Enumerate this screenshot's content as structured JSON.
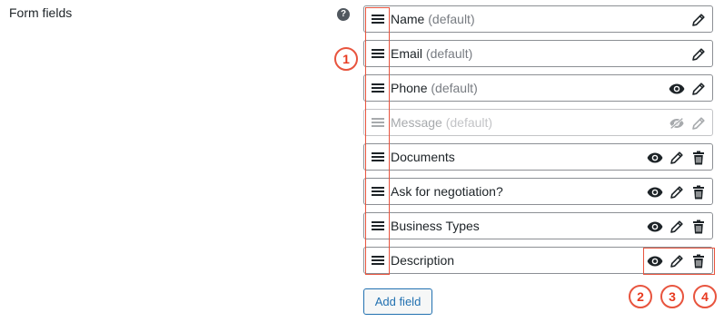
{
  "section": {
    "label": "Form fields",
    "help_icon": "question-circle-icon",
    "help_text": "?"
  },
  "fields": [
    {
      "name": "Name",
      "tag": "(default)",
      "enabled": true,
      "actions": [
        "edit"
      ]
    },
    {
      "name": "Email",
      "tag": "(default)",
      "enabled": true,
      "actions": [
        "edit"
      ]
    },
    {
      "name": "Phone",
      "tag": "(default)",
      "enabled": true,
      "actions": [
        "visibility",
        "edit"
      ]
    },
    {
      "name": "Message",
      "tag": "(default)",
      "enabled": false,
      "actions": [
        "visibility-hidden",
        "edit"
      ]
    },
    {
      "name": "Documents",
      "tag": "",
      "enabled": true,
      "actions": [
        "visibility",
        "edit",
        "delete"
      ]
    },
    {
      "name": "Ask for negotiation?",
      "tag": "",
      "enabled": true,
      "actions": [
        "visibility",
        "edit",
        "delete"
      ]
    },
    {
      "name": "Business Types",
      "tag": "",
      "enabled": true,
      "actions": [
        "visibility",
        "edit",
        "delete"
      ]
    },
    {
      "name": "Description",
      "tag": "",
      "enabled": true,
      "actions": [
        "visibility",
        "edit",
        "delete"
      ]
    }
  ],
  "add_field_label": "Add field",
  "callouts": [
    "1",
    "2",
    "3",
    "4"
  ],
  "colors": {
    "accent": "#2271b1",
    "annotation": "#e8543e",
    "text": "#1d2327",
    "muted": "#787c82",
    "disabled": "#a7aaad"
  }
}
